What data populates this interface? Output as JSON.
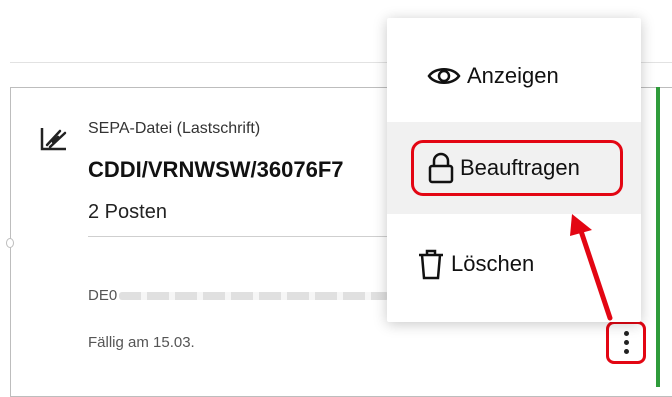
{
  "card": {
    "type_icon": "pen-sign-icon",
    "type_label": "SEPA-Datei (Lastschrift)",
    "reference": "CDDI/VRNWSW/36076F7",
    "items_count": "2 Posten",
    "iban_prefix": "DE0",
    "due_text": "Fällig am 15.03."
  },
  "menu": {
    "items": [
      {
        "label": "Anzeigen",
        "icon": "eye-icon"
      },
      {
        "label": "Beauftragen",
        "icon": "lock-icon"
      },
      {
        "label": "Löschen",
        "icon": "trash-icon"
      }
    ]
  },
  "colors": {
    "highlight_red": "#e30613",
    "accent_green": "#2e9b3a"
  }
}
